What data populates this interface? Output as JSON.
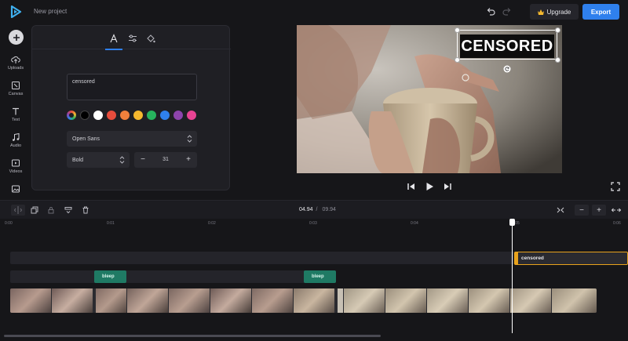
{
  "header": {
    "project_name": "New project",
    "upgrade_label": "Upgrade",
    "export_label": "Export"
  },
  "rail": {
    "items": [
      {
        "label": "Uploads",
        "icon": "upload-cloud-icon"
      },
      {
        "label": "Canvas",
        "icon": "canvas-icon"
      },
      {
        "label": "Text",
        "icon": "text-icon"
      },
      {
        "label": "Audio",
        "icon": "music-note-icon"
      },
      {
        "label": "Videos",
        "icon": "video-icon"
      },
      {
        "label": "",
        "icon": "image-icon"
      }
    ]
  },
  "text_panel": {
    "text_value": "censored",
    "font_family": "Open Sans",
    "font_weight": "Bold",
    "font_size": "31",
    "colors": [
      "#000000",
      "#ffffff",
      "#e74c3c",
      "#f0803c",
      "#f5b82e",
      "#27b35d",
      "#2f80ed",
      "#8e44ad",
      "#e84393"
    ]
  },
  "preview": {
    "overlay_text": "CENSORED"
  },
  "timeline": {
    "current_time": "04.94",
    "total_time": "09.94",
    "ruler_labels": [
      "0:00",
      "0:01",
      "0:02",
      "0:03",
      "0:04",
      "0:05",
      "0:06"
    ],
    "text_clip_label": "censored",
    "audio_clip_label": "bleep"
  },
  "colors": {
    "accent": "#2f80ed",
    "text_clip": "#e8a21c",
    "audio_clip": "#1f7a64"
  }
}
